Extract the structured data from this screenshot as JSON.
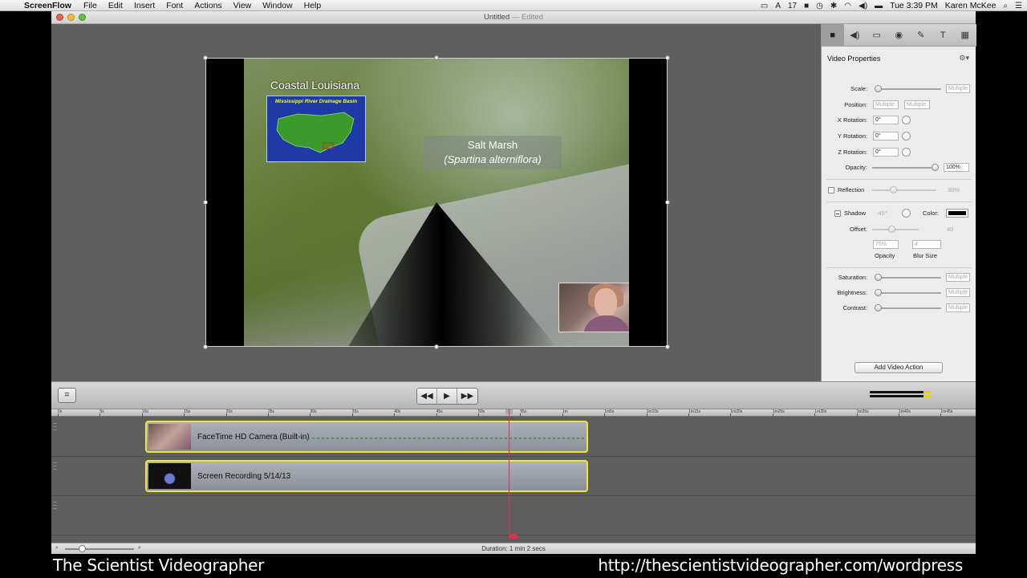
{
  "menubar": {
    "app_name": "ScreenFlow",
    "items": [
      "File",
      "Edit",
      "Insert",
      "Font",
      "Actions",
      "View",
      "Window",
      "Help"
    ],
    "status_badge": "17",
    "clock": "Tue 3:39 PM",
    "user": "Karen McKee"
  },
  "window": {
    "title": "Untitled",
    "title_suffix": "— Edited"
  },
  "canvas": {
    "slide_title": "Coastal Louisiana",
    "map_title": "Mississippi River Drainage Basin",
    "marsh_label": "Salt Marsh",
    "marsh_sci": "(Spartina alterniflora)"
  },
  "inspector": {
    "tabs": [
      "video-icon",
      "audio-icon",
      "screen-icon",
      "callout-icon",
      "annotation-icon",
      "text-icon",
      "media-icon"
    ],
    "heading": "Video Properties",
    "scale_label": "Scale:",
    "scale_value": "Multiple",
    "position_label": "Position:",
    "position_x": "Multiple",
    "position_y": "Multiple",
    "x_rot_label": "X Rotation:",
    "x_rot_value": "0°",
    "y_rot_label": "Y Rotation:",
    "y_rot_value": "0°",
    "z_rot_label": "Z Rotation:",
    "z_rot_value": "0°",
    "opacity_label": "Opacity:",
    "opacity_value": "100%",
    "reflection_label": "Reflection",
    "reflection_value": "30%",
    "shadow_label": "Shadow",
    "shadow_angle": "-45°",
    "color_label": "Color:",
    "offset_label": "Offset:",
    "offset_value": "40",
    "shadow_opacity_value": "75%",
    "blur_value": "4",
    "shadow_opacity_label": "Opacity",
    "blur_label": "Blur Size",
    "saturation_label": "Saturation:",
    "saturation_value": "Multiple",
    "brightness_label": "Brightness:",
    "brightness_value": "Multiple",
    "contrast_label": "Contrast:",
    "contrast_value": "Multiple",
    "add_action": "Add Video Action"
  },
  "transport": {
    "rewind": "◀◀",
    "play": "▶",
    "forward": "▶▶"
  },
  "timeline": {
    "ruler": [
      "0s",
      "5s",
      "10s",
      "15s",
      "20s",
      "25s",
      "30s",
      "35s",
      "40s",
      "45s",
      "50s",
      "55s",
      "1m",
      "1m5s",
      "1m10s",
      "1m15s",
      "1m20s",
      "1m25s",
      "1m30s",
      "1m35s",
      "1m40s",
      "1m45s"
    ],
    "clips": [
      {
        "label": "FaceTime HD Camera (Built-in)"
      },
      {
        "label": "Screen Recording 5/14/13"
      }
    ]
  },
  "status": {
    "duration": "Duration: 1 min 2 secs"
  },
  "captions": {
    "left": "The Scientist Videographer",
    "right": "http://thescientistvideographer.com/wordpress"
  }
}
